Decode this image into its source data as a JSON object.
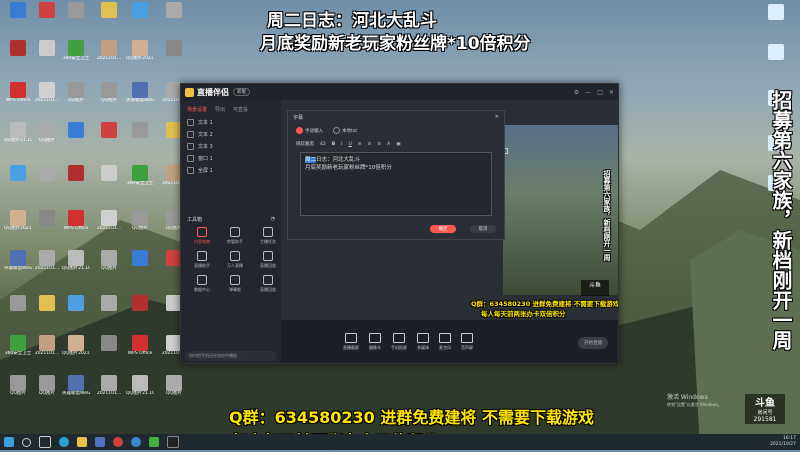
{
  "banners": {
    "top_line1": "周二日志：河北大乱斗",
    "top_line2": "月底奖励新老玩家粉丝牌*10倍积分",
    "bottom_line1": "Q群：634580230 进群免费建将 不需要下载游戏",
    "bottom_line2": "每人每天前两张办卡双倍积分",
    "right_vertical": "招募第六家族，新档刚开一周",
    "preview_vertical": "招募第六家族，新档刚开一周",
    "preview_line1": "Q群：634580230 进群免费建将 不需要下载游戏",
    "preview_line2": "每人每天前两张办卡双倍积分"
  },
  "desktop_icons": [
    {
      "label": "",
      "color": "#3a7bd5"
    },
    {
      "label": "",
      "color": "#d04040"
    },
    {
      "label": "",
      "color": "#999"
    },
    {
      "label": "",
      "color": "#e0c050"
    },
    {
      "label": "",
      "color": "#4aa0e0"
    },
    {
      "label": "",
      "color": "#aaa"
    },
    {
      "label": "",
      "color": "#b03030"
    },
    {
      "label": "",
      "color": "#ccc"
    },
    {
      "label": "360安全卫士",
      "color": "#40a040"
    },
    {
      "label": "2021101...",
      "color": "#c0a080"
    },
    {
      "label": "QQ图片2021101...",
      "color": "#d0b090"
    },
    {
      "label": "",
      "color": "#888"
    },
    {
      "label": "WPS Office",
      "color": "#d03030"
    },
    {
      "label": "2021101...",
      "color": "#d0d0d0"
    },
    {
      "label": "QQ图片",
      "color": "#999"
    },
    {
      "label": "QQ图片",
      "color": "#999"
    },
    {
      "label": "英雄联盟WeGame版",
      "color": "#5070b0"
    },
    {
      "label": "2021101...",
      "color": "#aaa"
    },
    {
      "label": "QQ图片21.10.13",
      "color": "#bbb"
    },
    {
      "label": "QQ图片",
      "color": "#aaa"
    }
  ],
  "app": {
    "title": "直播伴侣",
    "badge": "新版",
    "tabs": [
      "场景设置",
      "导出",
      "可直投"
    ],
    "sources": [
      "文本 1",
      "文本 2",
      "文本 3",
      "窗口 1",
      "全屏 1"
    ],
    "tools_title": "工具箱",
    "tools": [
      {
        "label": "抖音电商",
        "active": true
      },
      {
        "label": "房管助手",
        "active": false
      },
      {
        "label": "主播任务",
        "active": false
      },
      {
        "label": "直播助手",
        "active": false
      },
      {
        "label": "万人直播",
        "active": false
      },
      {
        "label": "直播回放",
        "active": false
      },
      {
        "label": "数据中心",
        "active": false
      },
      {
        "label": "弹幕姬",
        "active": false
      },
      {
        "label": "直播回放",
        "active": false
      }
    ],
    "footer_hint": "如何把手机还在加倍中播放...",
    "bottom_buttons": [
      "直播截屏",
      "摄像头",
      "手机投屏",
      "多媒体",
      "麦克风",
      "音声屏"
    ],
    "start_live": "开始直播"
  },
  "dialog": {
    "title": "字幕",
    "modes": [
      "手动输入",
      "本地txt"
    ],
    "font_label": "微软雅黑",
    "font_size": "42",
    "text_selected": "周二",
    "text_rest": "日志：河北大乱斗",
    "text_line2": "月底奖励新老玩家粉丝牌*10倍积分",
    "ok_label": "确定",
    "cancel_label": "取消"
  },
  "activate": {
    "line1": "激活 Windows",
    "line2": "转到\"设置\"以激活 Windows。"
  },
  "douyu": {
    "brand": "斗鱼",
    "room_label": "房间号",
    "room_id": "291581"
  },
  "tray": {
    "time": "16:17",
    "date": "2021/10/27"
  },
  "colors": {
    "accent": "#ff5a4f",
    "banner_yellow": "#ffe600"
  }
}
